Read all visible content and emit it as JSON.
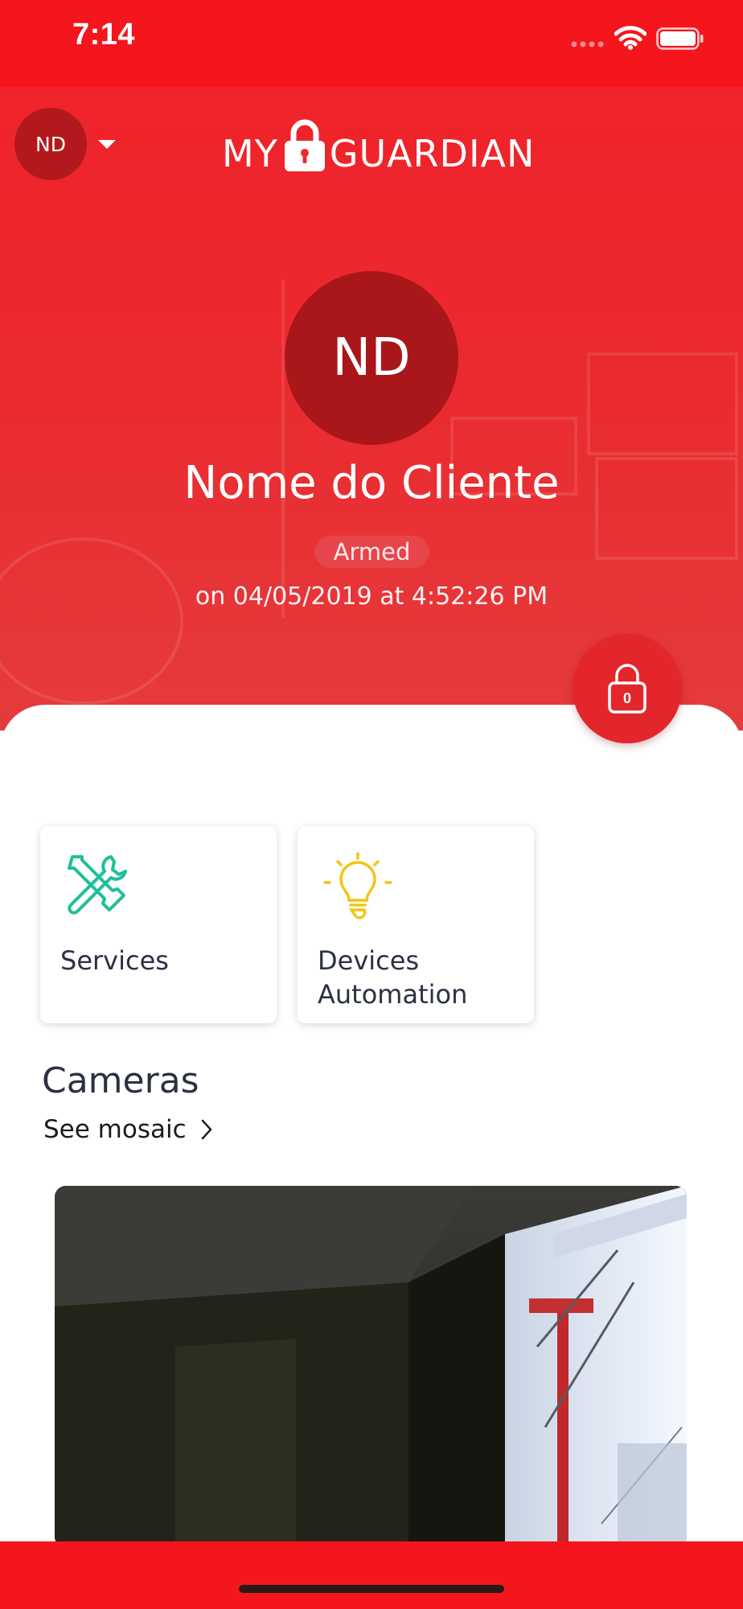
{
  "status_bar": {
    "time": "7:14",
    "icons": [
      "signal-icon",
      "wifi-icon",
      "battery-icon"
    ]
  },
  "header": {
    "account_initials": "ND",
    "logo_text_left": "MY",
    "logo_text_right": "GUARDIAN"
  },
  "profile": {
    "initials": "ND",
    "name": "Nome do Cliente",
    "status": "Armed",
    "status_date": "on 04/05/2019 at 4:52:26 PM"
  },
  "lock_button": {
    "count": "0"
  },
  "tiles": [
    {
      "label": "Services",
      "icon": "tools-icon"
    },
    {
      "label": "Devices Automation",
      "icon": "lightbulb-icon"
    }
  ],
  "cameras": {
    "title": "Cameras",
    "see_mosaic": "See mosaic"
  },
  "colors": {
    "brand_red": "#f5151c",
    "dark_red": "#a9171b",
    "services_icon": "#1fbf9a",
    "devices_icon": "#f2c51a",
    "text_dark": "#2b3142"
  }
}
